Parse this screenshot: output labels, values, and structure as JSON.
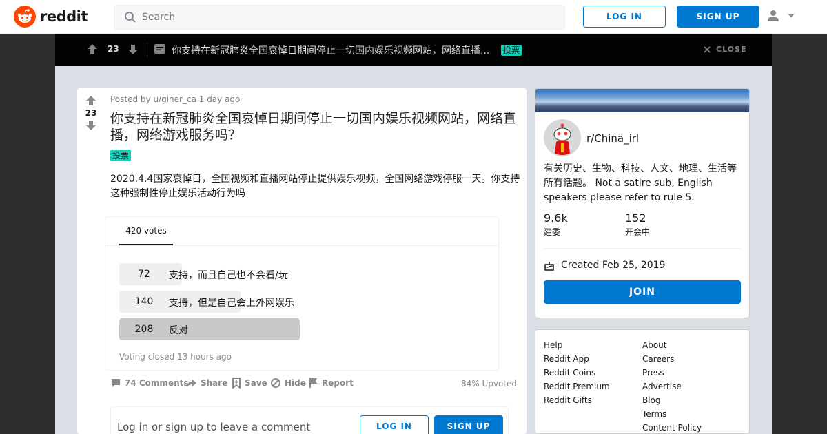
{
  "header": {
    "logo_text": "reddit",
    "search_placeholder": "Search",
    "login_label": "LOG IN",
    "signup_label": "SIGN UP"
  },
  "postbar": {
    "score": "23",
    "title": "你支持在新冠肺炎全国哀悼日期间停止一切国内娱乐视频网站，网络直播...",
    "flair": "投票",
    "close_label": "CLOSE"
  },
  "post": {
    "score": "23",
    "meta": "Posted by u/giner_ca 1 day ago",
    "title": "你支持在新冠肺炎全国哀悼日期间停止一切国内娱乐视频网站，网络直播，网络游戏服务吗？",
    "flair": "投票",
    "body": "2020.4.4国家哀悼日，全国视频和直播网站停止提供娱乐视频，全国网络游戏停服一天。你支持这种强制性停止娱乐活动行为吗",
    "poll": {
      "tab_label": "420 votes",
      "total": 420,
      "options": [
        {
          "count": "72",
          "label": "支持，而且自己也不会看/玩",
          "votes": 72
        },
        {
          "count": "140",
          "label": "支持，但是自己会上外网娱乐",
          "votes": 140
        },
        {
          "count": "208",
          "label": "反对",
          "votes": 208
        }
      ],
      "status": "Voting closed 13 hours ago"
    },
    "actions": {
      "comments": "74 Comments",
      "share": "Share",
      "save": "Save",
      "hide": "Hide",
      "report": "Report",
      "upvoted": "84% Upvoted"
    },
    "comment_box": {
      "prompt": "Log in or sign up to leave a comment",
      "login_label": "LOG IN",
      "signup_label": "SIGN UP"
    }
  },
  "sidebar": {
    "sub_name": "r/China_irl",
    "description": "有关历史、生物、科技、人文、地理、生活等所有话题。 Not a satire sub, English speakers please refer to rule 5.",
    "members_num": "9.6k",
    "members_label": "建委",
    "online_num": "152",
    "online_label": "开会中",
    "created": "Created Feb 25, 2019",
    "join_label": "JOIN"
  },
  "footer_links": {
    "col1": [
      "Help",
      "Reddit App",
      "Reddit Coins",
      "Reddit Premium",
      "Reddit Gifts"
    ],
    "col2": [
      "About",
      "Careers",
      "Press",
      "Advertise",
      "Blog",
      "Terms",
      "Content Policy"
    ]
  },
  "colors": {
    "brand": "#ff4500",
    "accent": "#0079d3",
    "flair": "#0dd3bb"
  }
}
